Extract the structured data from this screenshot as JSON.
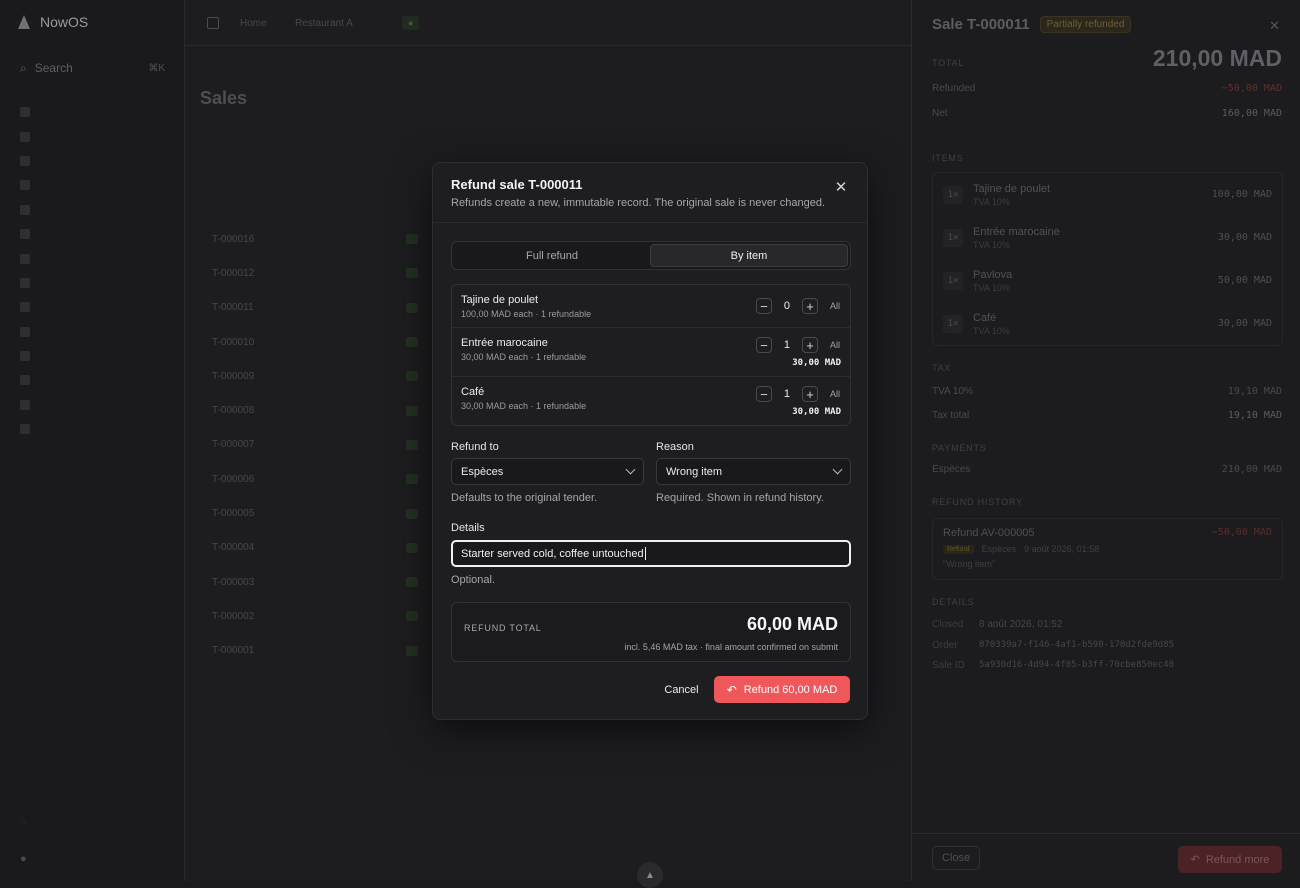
{
  "app": {
    "brand": "NowOS",
    "search_placeholder": "Search",
    "search_kbd": "⌘K",
    "sidebar_items": [
      {
        "label": "",
        "count": ""
      },
      {
        "label": "",
        "count": ""
      },
      {
        "label": "",
        "count": ""
      },
      {
        "label": "",
        "count": ""
      },
      {
        "label": "",
        "count": ""
      },
      {
        "label": "",
        "count": ""
      },
      {
        "label": "",
        "count": ""
      },
      {
        "label": "",
        "count": ""
      },
      {
        "label": "",
        "count": ""
      },
      {
        "label": "",
        "count": ""
      },
      {
        "label": "",
        "count": ""
      },
      {
        "label": "",
        "count": ""
      },
      {
        "label": "",
        "count": ""
      },
      {
        "label": "",
        "count": ""
      }
    ],
    "topbar": {
      "crumb1": "Home",
      "crumb2": "Restaurant A"
    },
    "page": {
      "breadcrumb": "",
      "title": "Sales",
      "subtitle": ""
    },
    "rows": [
      "T-000016",
      "T-000012",
      "T-000011",
      "T-000010",
      "T-000009",
      "T-000008",
      "T-000007",
      "T-000006",
      "T-000005",
      "T-000004",
      "T-000003",
      "T-000002",
      "T-000001"
    ]
  },
  "drawer": {
    "title": "Sale T-000011",
    "status_badge": "Partially refunded",
    "total_label": "TOTAL",
    "total_value": "210,00 MAD",
    "refunded_label": "Refunded",
    "refunded_value": "−50,00 MAD",
    "net_label": "Net",
    "net_value": "160,00 MAD",
    "items_label": "ITEMS",
    "items": [
      {
        "qty": "1×",
        "name": "Tajine de poulet",
        "tax": "TVA 10%",
        "price": "100,00 MAD"
      },
      {
        "qty": "1×",
        "name": "Entrée marocaine",
        "tax": "TVA 10%",
        "price": "30,00 MAD"
      },
      {
        "qty": "1×",
        "name": "Pavlova",
        "tax": "TVA 10%",
        "price": "50,00 MAD"
      },
      {
        "qty": "1×",
        "name": "Café",
        "tax": "TVA 10%",
        "price": "30,00 MAD"
      }
    ],
    "tax_label": "TAX",
    "tva_label": "TVA 10%",
    "tva_value": "19,10 MAD",
    "tax_total_label": "Tax total",
    "tax_total_value": "19,10 MAD",
    "payments_label": "PAYMENTS",
    "payment_method": "Espèces",
    "payment_value": "210,00 MAD",
    "refund_history_label": "REFUND HISTORY",
    "refund_history": {
      "name": "Refund AV-000005",
      "amount": "−50,00 MAD",
      "tag": "Refund",
      "method": "Espèces",
      "date": "9 août 2026, 01:58",
      "reason": "\"Wrong item\""
    },
    "details_label": "DETAILS",
    "details": [
      {
        "k": "Closed",
        "v": "8 août 2026, 01:52"
      },
      {
        "k": "Order",
        "v": "870339a7-f146-4af1-b590-170d2fde9d85"
      },
      {
        "k": "Sale ID",
        "v": "5a930d16-4d94-4f05-b3ff-70cbe850ec40"
      }
    ],
    "close_button": "Close",
    "refund_more_button": "Refund more"
  },
  "modal": {
    "title": "Refund sale T-000011",
    "subtitle": "Refunds create a new, immutable record. The original sale is never changed.",
    "tabs": {
      "full": "Full refund",
      "by_item": "By item"
    },
    "lines": [
      {
        "name": "Tajine de poulet",
        "sub": "100,00 MAD each · 1 refundable",
        "qty": "0",
        "all": "All",
        "amount": ""
      },
      {
        "name": "Entrée marocaine",
        "sub": "30,00 MAD each · 1 refundable",
        "qty": "1",
        "all": "All",
        "amount": "30,00 MAD"
      },
      {
        "name": "Café",
        "sub": "30,00 MAD each · 1 refundable",
        "qty": "1",
        "all": "All",
        "amount": "30,00 MAD"
      }
    ],
    "refund_to_label": "Refund to",
    "refund_to_value": "Espèces",
    "refund_to_hint": "Defaults to the original tender.",
    "reason_label": "Reason",
    "reason_value": "Wrong item",
    "reason_hint": "Required. Shown in refund history.",
    "details_label": "Details",
    "details_value": "Starter served cold, coffee untouched",
    "details_hint": "Optional.",
    "total_label": "REFUND TOTAL",
    "total_value": "60,00 MAD",
    "total_note": "incl. 5,46 MAD tax · final amount confirmed on submit",
    "cancel": "Cancel",
    "submit": "Refund 60,00 MAD"
  }
}
